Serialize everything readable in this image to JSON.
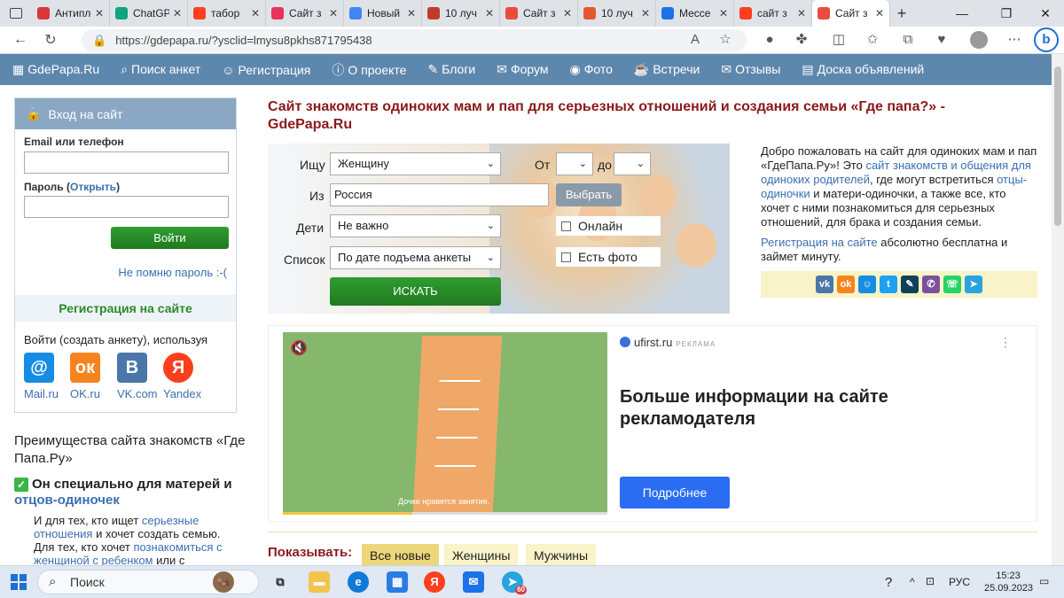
{
  "browser": {
    "tabs": [
      {
        "title": "Антипл",
        "color": "#d9363e"
      },
      {
        "title": "ChatGP",
        "color": "#10a37f"
      },
      {
        "title": "табор",
        "color": "#fc3f1d"
      },
      {
        "title": "Сайт з",
        "color": "#e8315b"
      },
      {
        "title": "Новый",
        "color": "#4285f4"
      },
      {
        "title": "10 луч",
        "color": "#c0392b"
      },
      {
        "title": "Сайт з",
        "color": "#e84c3d"
      },
      {
        "title": "10 луч",
        "color": "#e4572e"
      },
      {
        "title": "Мессе",
        "color": "#1a73e8"
      },
      {
        "title": "сайт з",
        "color": "#fc3f1d"
      },
      {
        "title": "Сайт з",
        "color": "#e84c3d"
      }
    ],
    "url": "https://gdepapa.ru/?ysclid=lmysu8pkhs871795438"
  },
  "nav": {
    "items": [
      "GdePapa.Ru",
      "Поиск анкет",
      "Регистрация",
      "О проекте",
      "Блоги",
      "Форум",
      "Фото",
      "Встречи",
      "Отзывы",
      "Доска объявлений"
    ]
  },
  "login": {
    "header": "Вход на сайт",
    "email_label": "Email или телефон",
    "password_label": "Пароль (",
    "password_show": "Открыть",
    "password_close": ")",
    "submit": "Войти",
    "forgot": "Не помню пароль :-(",
    "register": "Регистрация на сайте",
    "via": "Войти (создать анкету), используя",
    "providers": [
      "Mail.ru",
      "OK.ru",
      "VK.com",
      "Yandex"
    ]
  },
  "advantages": {
    "heading": "Преимущества сайта знакомств «Где Папа.Ру»",
    "point_bold": "Он специально для матерей и ",
    "point_link": "отцов-одиночек",
    "d1_pre": "И для тех, кто ищет ",
    "d1_link": "серьезные отношения",
    "d1_post": " и хочет создать семью.",
    "d2_pre": "Для тех, кто хочет ",
    "d2_link": "познакомиться с женщиной с ребенком",
    "d2_post": " или с"
  },
  "main": {
    "title": "Сайт знакомств одиноких мам и пап для серьезных отношений и создания семьи «Где папа?» - GdePapa.Ru"
  },
  "search": {
    "seek_label": "Ищу",
    "seek_value": "Женщину",
    "from_label": "От",
    "to_label": "до",
    "place_label": "Из",
    "place_value": "Россия",
    "choose": "Выбрать",
    "kids_label": "Дети",
    "kids_value": "Не важно",
    "online": "Онлайн",
    "list_label": "Список",
    "list_value": "По дате подъема анкеты",
    "has_photo": "Есть фото",
    "submit": "ИСКАТЬ"
  },
  "welcome": {
    "p1_a": "Добро пожаловать на сайт для одиноких мам и пап «ГдеПапа.Ру»! Это ",
    "p1_link1": "сайт знакомств и общения для одиноких родителей",
    "p1_b": ", где могут встретиться ",
    "p1_link2": "отцы-одиночки",
    "p1_c": " и матери-одиночки, а также все, кто хочет с ними познакомиться для серьезных отношений, для брака и создания семьи.",
    "p2_link": "Регистрация на сайте",
    "p2_rest": " абсолютно бесплатна и займет минуту."
  },
  "share_icons": [
    "vk-icon",
    "ok-icon",
    "moimir-icon",
    "twitter-icon",
    "livejournal-icon",
    "viber-icon",
    "whatsapp-icon",
    "telegram-icon"
  ],
  "ad": {
    "source": "ufirst.ru",
    "tag": "РЕКЛАМА",
    "caption": "Дочке нравятся занятия.",
    "title": "Больше информации на сайте рекламодателя",
    "button": "Подробнее",
    "video_progress": 0.4
  },
  "filter": {
    "label": "Показывать:",
    "chips": [
      "Все новые",
      "Женщины",
      "Мужчины"
    ]
  },
  "taskbar": {
    "search": "Поиск",
    "lang": "РУС",
    "time": "15:23",
    "date": "25.09.2023",
    "telegram_badge": "60"
  }
}
